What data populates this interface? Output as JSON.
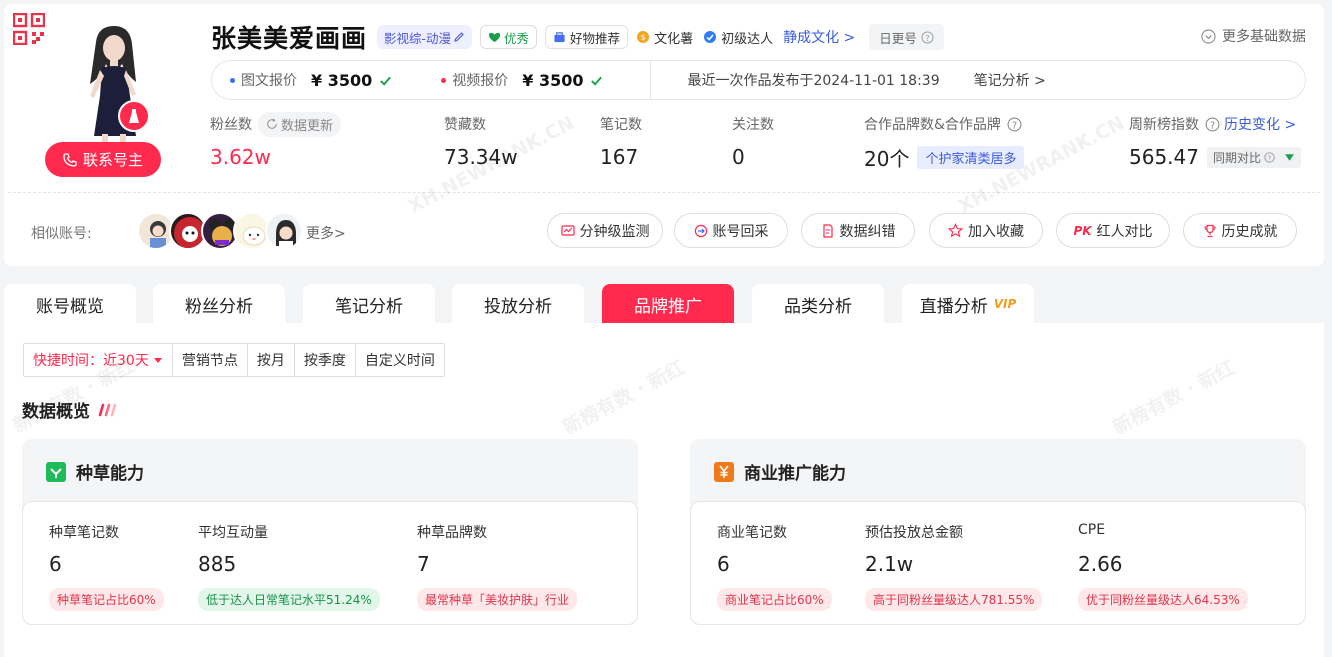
{
  "profile": {
    "name": "张美美爱画画",
    "category_tag": "影视综-动漫",
    "quality_tag": "优秀",
    "tag_recommend": "好物推荐",
    "tag_culture": "文化薯",
    "tag_level": "初级达人",
    "agency_link": "静成文化 >",
    "daily_update": "日更号",
    "more_basic": "更多基础数据",
    "contact_button": "联系号主"
  },
  "prices": {
    "image_label": "图文报价",
    "image_value": "¥ 3500",
    "video_label": "视频报价",
    "video_value": "¥ 3500",
    "last_post": "最近一次作品发布于2024-11-01 18:39",
    "note_analysis": "笔记分析 >"
  },
  "stats": {
    "fans_label": "粉丝数",
    "fans_refresh": "数据更新",
    "fans_value": "3.62w",
    "likes_label": "赞藏数",
    "likes_value": "73.34w",
    "notes_label": "笔记数",
    "notes_value": "167",
    "follow_label": "关注数",
    "follow_value": "0",
    "brand_label": "合作品牌数&合作品牌",
    "brand_value": "20个",
    "brand_chip": "个护家清类居多",
    "rank_label": "周新榜指数",
    "rank_link": "历史变化 >",
    "rank_value": "565.47",
    "rank_compare": "同期对比"
  },
  "similar": {
    "label": "相似账号:",
    "more": "更多>"
  },
  "actions": {
    "monitor": "分钟级监测",
    "recollect": "账号回采",
    "correct": "数据纠错",
    "favorite": "加入收藏",
    "compare": "红人对比",
    "history": "历史成就"
  },
  "tabs": [
    "账号概览",
    "粉丝分析",
    "笔记分析",
    "投放分析",
    "品牌推广",
    "品类分析",
    "直播分析"
  ],
  "tab_vip": "VIP",
  "filter": {
    "quick": "快捷时间：近30天",
    "marketing": "营销节点",
    "month": "按月",
    "quarter": "按季度",
    "custom": "自定义时间"
  },
  "overview_title": "数据概览",
  "seeding": {
    "title": "种草能力",
    "m1_label": "种草笔记数",
    "m1_value": "6",
    "m1_chip": "种草笔记占比60%",
    "m2_label": "平均互动量",
    "m2_value": "885",
    "m2_chip": "低于达人日常笔记水平51.24%",
    "m3_label": "种草品牌数",
    "m3_value": "7",
    "m3_chip": "最常种草「美妆护肤」行业"
  },
  "commercial": {
    "title": "商业推广能力",
    "m1_label": "商业笔记数",
    "m1_value": "6",
    "m1_chip": "商业笔记占比60%",
    "m2_label": "预估投放总金额",
    "m2_value": "2.1w",
    "m2_chip": "高于同粉丝量级达人781.55%",
    "m3_label": "CPE",
    "m3_value": "2.66",
    "m3_chip": "优于同粉丝量级达人64.53%"
  },
  "watermarks": {
    "site": "XH.NEWRANK.CN",
    "brand": "新榜有数 · 新红"
  },
  "colors": {
    "accent": "#ff2a4d",
    "link": "#3b5bdb",
    "success": "#1a9e4b"
  }
}
